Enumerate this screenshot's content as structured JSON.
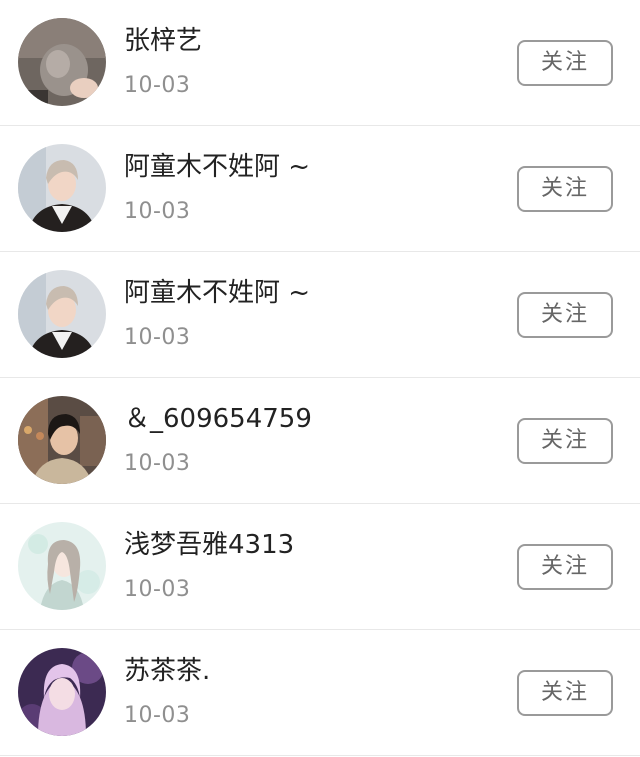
{
  "follow_list": {
    "items": [
      {
        "name": "张梓艺",
        "date": "10-03",
        "button_label": "关注",
        "avatar": "avatar-photo-holding-pet"
      },
      {
        "name": "阿童木不姓阿 ~",
        "date": "10-03",
        "button_label": "关注",
        "avatar": "avatar-photo-young-man-silver-hair"
      },
      {
        "name": "阿童木不姓阿 ~",
        "date": "10-03",
        "button_label": "关注",
        "avatar": "avatar-photo-young-man-silver-hair"
      },
      {
        "name": "＆_609654759",
        "date": "10-03",
        "button_label": "关注",
        "avatar": "avatar-photo-man-dark-hair"
      },
      {
        "name": "浅梦吾雅4313",
        "date": "10-03",
        "button_label": "关注",
        "avatar": "avatar-illustration-anime-girl"
      },
      {
        "name": "苏茶茶.",
        "date": "10-03",
        "button_label": "关注",
        "avatar": "avatar-photo-girl-pink-hair"
      }
    ]
  }
}
